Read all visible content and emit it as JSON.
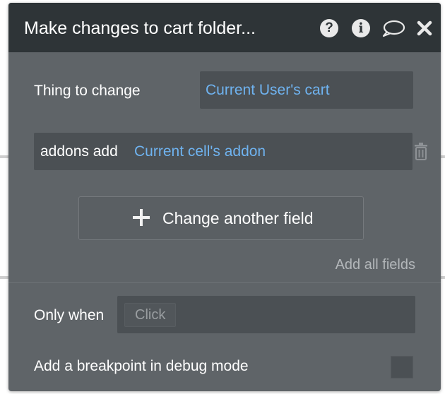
{
  "colors": {
    "panel_bg": "#5f6468",
    "header_bg": "#2e3437",
    "field_bg": "#4b5054",
    "link": "#6fb3f0",
    "muted_text": "#b3b7ba"
  },
  "header": {
    "title": "Make changes to cart folder...",
    "icons": [
      "help-icon",
      "info-icon",
      "comment-icon",
      "close-icon"
    ],
    "help_glyph": "?",
    "info_glyph": "i"
  },
  "thing_to_change": {
    "label": "Thing to change",
    "value": "Current User's cart"
  },
  "field_change": {
    "field": "addons add",
    "value": "Current cell's addon",
    "delete_icon": "trash-icon"
  },
  "change_another": {
    "label": "Change another field",
    "icon": "plus-icon"
  },
  "add_all_fields": "Add all fields",
  "only_when": {
    "label": "Only when",
    "placeholder": "Click"
  },
  "breakpoint": {
    "label": "Add a breakpoint in debug mode",
    "checked": false
  }
}
